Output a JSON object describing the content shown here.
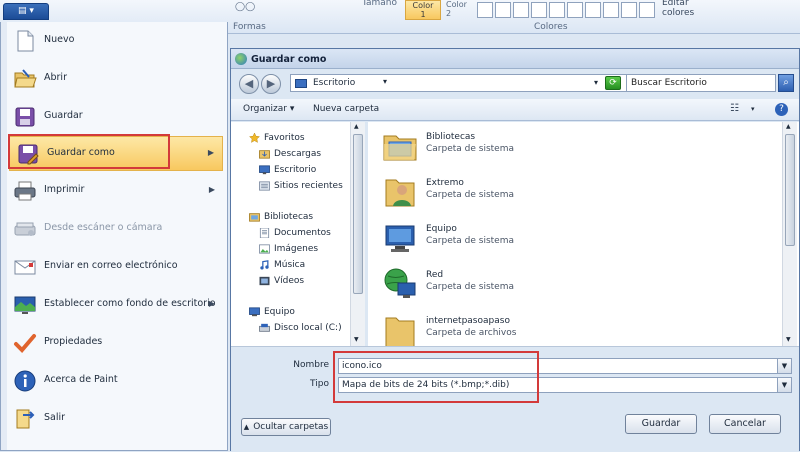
{
  "ribbon": {
    "shapes_group": "Formas",
    "size_label": "Tamaño",
    "color1": "Color\n1",
    "color2": "Color\n2",
    "colors_group": "Colores",
    "edit_colors": "Editar\ncolores"
  },
  "menu": {
    "items": [
      {
        "label": "Nuevo",
        "icon": "new-document-icon",
        "submenu": false,
        "disabled": false
      },
      {
        "label": "Abrir",
        "icon": "open-folder-icon",
        "submenu": false,
        "disabled": false
      },
      {
        "label": "Guardar",
        "icon": "save-icon",
        "submenu": false,
        "disabled": false
      },
      {
        "label": "Guardar como",
        "icon": "save-as-icon",
        "submenu": true,
        "disabled": false,
        "highlighted": true
      },
      {
        "label": "Imprimir",
        "icon": "printer-icon",
        "submenu": true,
        "disabled": false
      },
      {
        "label": "Desde escáner o cámara",
        "icon": "scanner-icon",
        "submenu": false,
        "disabled": true
      },
      {
        "label": "Enviar en correo electrónico",
        "icon": "email-icon",
        "submenu": false,
        "disabled": false
      },
      {
        "label": "Establecer como fondo de escritorio",
        "icon": "desktop-background-icon",
        "submenu": true,
        "disabled": false
      },
      {
        "label": "Propiedades",
        "icon": "checkmark-icon",
        "submenu": false,
        "disabled": false
      },
      {
        "label": "Acerca de Paint",
        "icon": "info-icon",
        "submenu": false,
        "disabled": false
      },
      {
        "label": "Salir",
        "icon": "exit-icon",
        "submenu": false,
        "disabled": false
      }
    ]
  },
  "dialog": {
    "title": "Guardar como",
    "address": "Escritorio",
    "search_placeholder": "Buscar Escritorio",
    "organize": "Organizar",
    "new_folder": "Nueva carpeta",
    "nav": [
      {
        "label": "Favoritos",
        "icon": "star-icon"
      },
      {
        "label": "Descargas",
        "icon": "downloads-folder-icon"
      },
      {
        "label": "Escritorio",
        "icon": "desktop-icon"
      },
      {
        "label": "Sitios recientes",
        "icon": "recent-places-icon"
      },
      {
        "label": "Bibliotecas",
        "icon": "libraries-icon"
      },
      {
        "label": "Documentos",
        "icon": "documents-icon"
      },
      {
        "label": "Imágenes",
        "icon": "pictures-icon"
      },
      {
        "label": "Música",
        "icon": "music-icon"
      },
      {
        "label": "Vídeos",
        "icon": "videos-icon"
      },
      {
        "label": "Equipo",
        "icon": "computer-icon"
      },
      {
        "label": "Disco local (C:)",
        "icon": "drive-icon"
      }
    ],
    "files": [
      {
        "name": "Bibliotecas",
        "type": "Carpeta de sistema",
        "icon": "libraries-folder-icon"
      },
      {
        "name": "Extremo",
        "type": "Carpeta de sistema",
        "icon": "user-folder-icon"
      },
      {
        "name": "Equipo",
        "type": "Carpeta de sistema",
        "icon": "computer-icon"
      },
      {
        "name": "Red",
        "type": "Carpeta de sistema",
        "icon": "network-icon"
      },
      {
        "name": "internetpasoapaso",
        "type": "Carpeta de archivos",
        "icon": "folder-icon"
      }
    ],
    "filename_label": "Nombre",
    "filename_value": "icono.ico",
    "type_label": "Tipo",
    "type_value": "Mapa de bits de 24 bits (*.bmp;*.dib)",
    "hide_folders": "Ocultar carpetas",
    "save": "Guardar",
    "cancel": "Cancelar"
  }
}
